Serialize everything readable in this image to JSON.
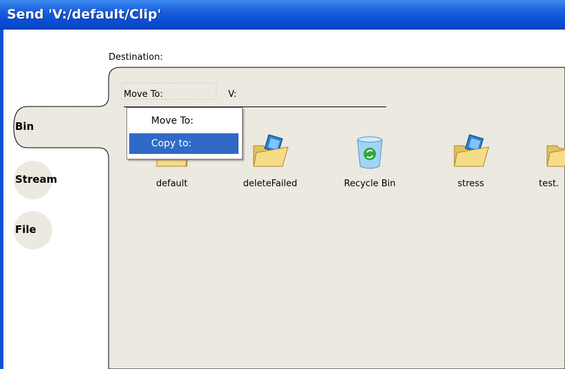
{
  "window": {
    "title": "Send 'V:/default/Clip'"
  },
  "destination": {
    "label": "Destination:"
  },
  "tabs": [
    {
      "label": "Bin",
      "selected": true
    },
    {
      "label": "Stream",
      "selected": false
    },
    {
      "label": "File",
      "selected": false
    }
  ],
  "action": {
    "label": "Move To:",
    "path": "V:"
  },
  "dropdown": {
    "options": [
      {
        "label": "Move To:",
        "selected": false
      },
      {
        "label": "Copy to:",
        "selected": true
      }
    ]
  },
  "items": [
    {
      "label": "default",
      "icon": "folder-icon"
    },
    {
      "label": "deleteFailed",
      "icon": "folder-clip-icon"
    },
    {
      "label": "Recycle Bin",
      "icon": "recycle-bin-icon"
    },
    {
      "label": "stress",
      "icon": "folder-clip-icon"
    },
    {
      "label": "test.",
      "icon": "folder-clip-icon"
    }
  ],
  "colors": {
    "titlebar": "#0a4fd6",
    "selection": "#316ac5",
    "panel": "#ece9e0"
  }
}
